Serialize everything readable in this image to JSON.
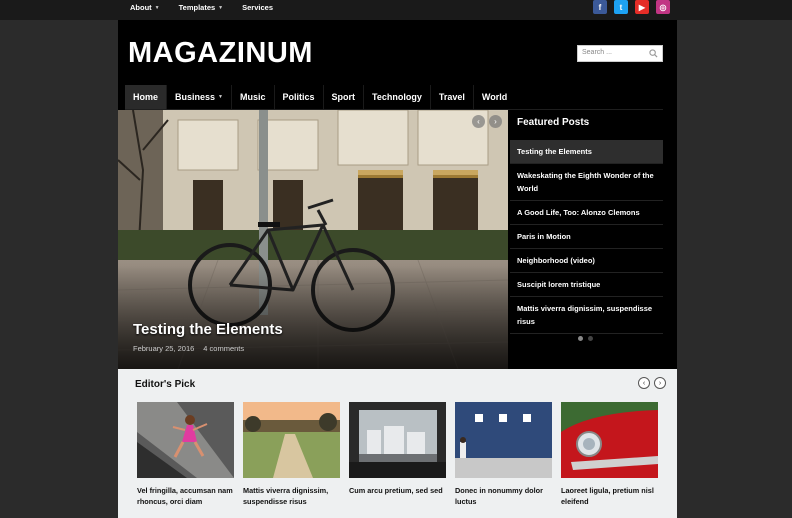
{
  "topbar": {
    "nav": [
      {
        "label": "About",
        "dropdown": true
      },
      {
        "label": "Templates",
        "dropdown": true
      },
      {
        "label": "Services",
        "dropdown": false
      }
    ],
    "social": [
      {
        "icon": "facebook-icon",
        "glyph": "f",
        "color": "#3b5998"
      },
      {
        "icon": "twitter-icon",
        "glyph": "t",
        "color": "#1da1f2"
      },
      {
        "icon": "youtube-icon",
        "glyph": "▶",
        "color": "#e52d27"
      },
      {
        "icon": "instagram-icon",
        "glyph": "◎",
        "color": "#c13584"
      }
    ]
  },
  "header": {
    "logo": "MAGAZINUM",
    "search_placeholder": "Search ...",
    "search_icon": "search-icon"
  },
  "mainnav": {
    "items": [
      {
        "label": "Home",
        "active": true,
        "dropdown": false
      },
      {
        "label": "Business",
        "active": false,
        "dropdown": true
      },
      {
        "label": "Music",
        "active": false,
        "dropdown": false
      },
      {
        "label": "Politics",
        "active": false,
        "dropdown": false
      },
      {
        "label": "Sport",
        "active": false,
        "dropdown": false
      },
      {
        "label": "Technology",
        "active": false,
        "dropdown": false
      },
      {
        "label": "Travel",
        "active": false,
        "dropdown": false
      },
      {
        "label": "World",
        "active": false,
        "dropdown": false
      }
    ]
  },
  "slider": {
    "title": "Testing the Elements",
    "date": "February 25, 2016",
    "comments": "4 comments",
    "prev": "‹",
    "next": "›"
  },
  "featured": {
    "title": "Featured Posts",
    "items": [
      {
        "label": "Testing the Elements",
        "active": true
      },
      {
        "label": "Wakeskating the Eighth Wonder of the World",
        "active": false
      },
      {
        "label": "A Good Life, Too: Alonzo Clemons",
        "active": false
      },
      {
        "label": "Paris in Motion",
        "active": false
      },
      {
        "label": "Neighborhood (video)",
        "active": false
      },
      {
        "label": "Suscipit lorem tristique",
        "active": false
      },
      {
        "label": "Mattis viverra dignissim, suspendisse risus",
        "active": false
      }
    ]
  },
  "editors_pick": {
    "title": "Editor's Pick",
    "prev": "‹",
    "next": "›",
    "cards": [
      {
        "caption": "Vel fringilla, accumsan nam rhoncus, orci diam"
      },
      {
        "caption": "Mattis viverra dignissim, suspendisse risus"
      },
      {
        "caption": "Cum arcu pretium, sed sed"
      },
      {
        "caption": "Donec in nonummy dolor luctus"
      },
      {
        "caption": "Laoreet ligula, pretium nisl eleifend"
      }
    ]
  },
  "colors": {
    "page_bg": "#2b2b2b",
    "site_bg": "#000000",
    "editors_bg": "#eef0f1"
  }
}
